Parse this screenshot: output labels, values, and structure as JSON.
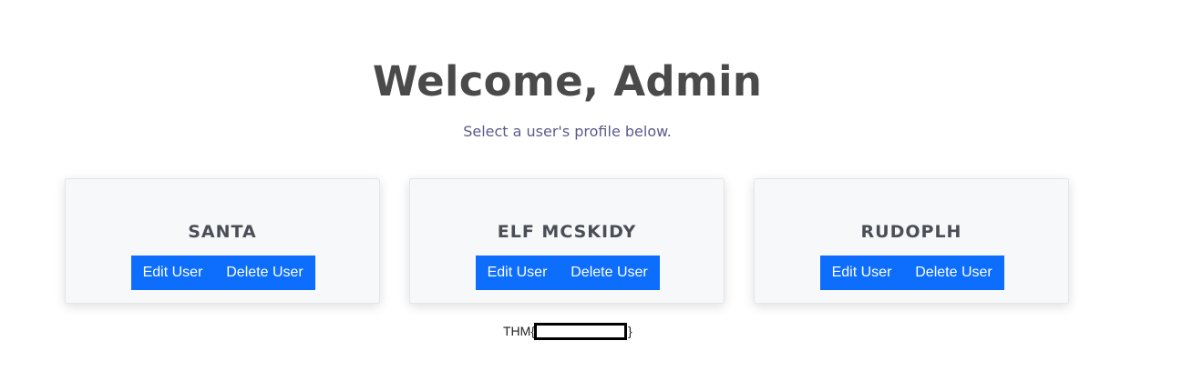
{
  "header": {
    "title": "Welcome, Admin",
    "subtitle": "Select a user's profile below."
  },
  "users": [
    {
      "name": "SANTA",
      "edit_label": "Edit User",
      "delete_label": "Delete User"
    },
    {
      "name": "ELF MCSKIDY",
      "edit_label": "Edit User",
      "delete_label": "Delete User"
    },
    {
      "name": "RUDOPLH",
      "edit_label": "Edit User",
      "delete_label": "Delete User"
    }
  ],
  "footer": {
    "flag_prefix": "THM{",
    "flag_suffix": "}"
  },
  "colors": {
    "button": "#0d6efd",
    "title": "#4a4a4a",
    "subtitle": "#5a5b8c",
    "card_bg": "#f7f8fa"
  }
}
